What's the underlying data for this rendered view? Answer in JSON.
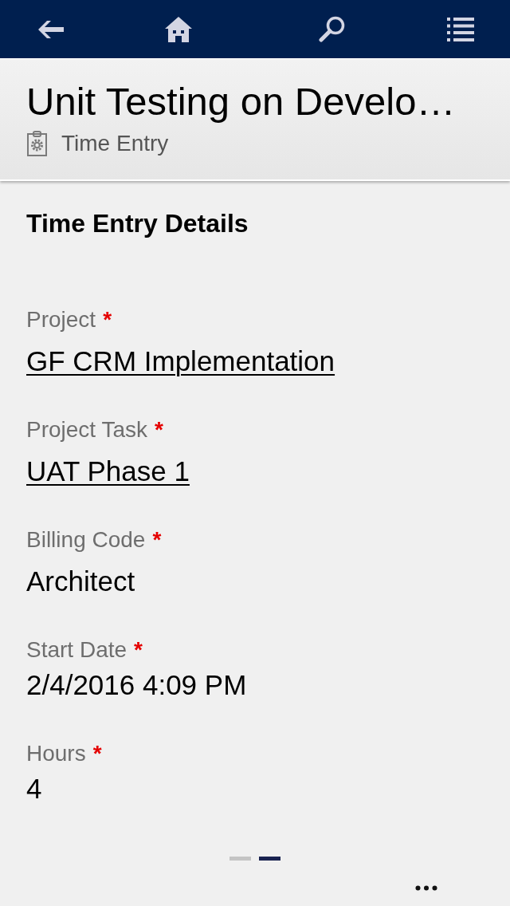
{
  "header": {
    "title": "Unit Testing on Develo…",
    "entity": "Time Entry"
  },
  "section": {
    "title": "Time Entry Details"
  },
  "fields": [
    {
      "label": "Project",
      "required_marker": "*",
      "value": "GF CRM Implementation",
      "kind": "lookup"
    },
    {
      "label": "Project Task",
      "required_marker": "*",
      "value": "UAT Phase 1",
      "kind": "lookup"
    },
    {
      "label": "Billing Code",
      "required_marker": "*",
      "value": "Architect",
      "kind": "optionset"
    },
    {
      "label": "Start Date",
      "required_marker": "*",
      "value": "2/4/2016 4:09 PM",
      "kind": "text"
    },
    {
      "label": "Hours",
      "required_marker": "*",
      "value": "4",
      "kind": "text"
    }
  ],
  "pages": [
    {
      "selected": false
    },
    {
      "selected": true
    }
  ]
}
